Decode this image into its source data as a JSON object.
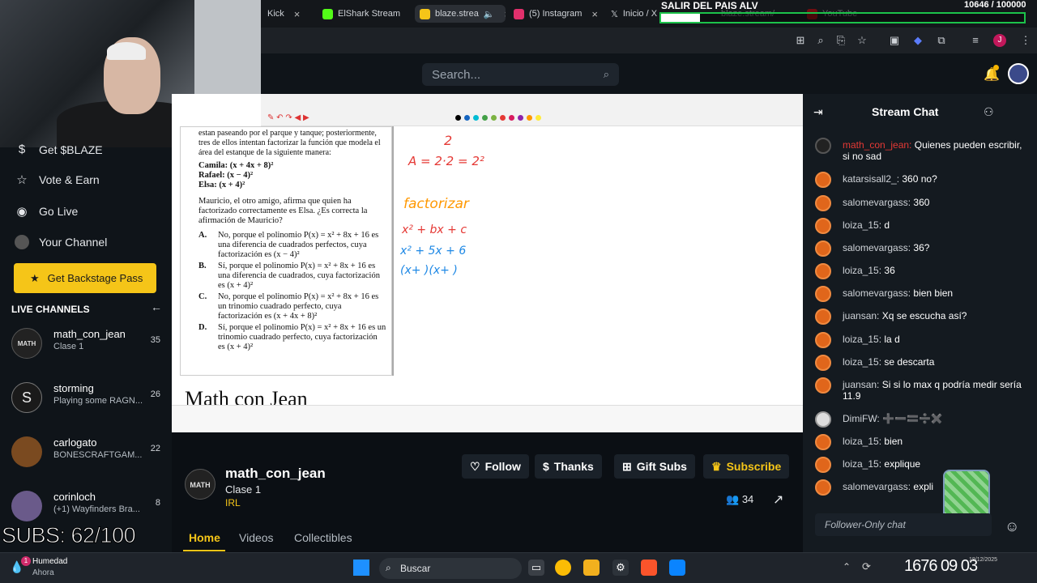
{
  "browser": {
    "tabs": [
      {
        "label": "Kick",
        "favicon_color": "#53fc18"
      },
      {
        "label": "ElShark Stream",
        "favicon_color": "#53fc18"
      },
      {
        "label": "blaze.strea",
        "favicon_color": "#f5c518"
      },
      {
        "label": "(5) Instagram",
        "favicon_color": "#e1306c"
      },
      {
        "label": "Inicio / X",
        "favicon_color": "#ffffff"
      }
    ],
    "overlay_tabs": [
      "blaze.stream/",
      "YouTube"
    ]
  },
  "goal": {
    "title": "SALIR DEL PAIS ALV",
    "count": "10646 / 100000",
    "progress_fraction": 0.1065
  },
  "header": {
    "search_placeholder": "Search..."
  },
  "sidebar": {
    "items": [
      {
        "label": "Get $BLAZE",
        "icon": "dollar-icon"
      },
      {
        "label": "Vote & Earn",
        "icon": "star-icon"
      },
      {
        "label": "Go Live",
        "icon": "broadcast-icon"
      },
      {
        "label": "Your Channel",
        "icon": "avatar"
      }
    ],
    "backstage_label": "Get Backstage Pass",
    "live_channels_heading": "LIVE CHANNELS",
    "channels": [
      {
        "name": "math_con_jean",
        "subtitle": "Clase 1",
        "viewers": "35",
        "avatar_color": "#222222"
      },
      {
        "name": "storming",
        "subtitle": "Playing some RAGN...",
        "viewers": "26",
        "avatar_color": "#1a1a1a"
      },
      {
        "name": "carlogato",
        "subtitle": "BONESCRAFTGAM...",
        "viewers": "22",
        "avatar_color": "#7a4a20"
      },
      {
        "name": "corinloch",
        "subtitle": "(+1) Wayfinders Bra...",
        "viewers": "8",
        "avatar_color": "#6a5a8a"
      }
    ]
  },
  "player": {
    "doc_text": {
      "intro": "estan paseando por el parque y tanque; posteriormente, tres de ellos intentan factorizar la función que modela el área del estanque de la siguiente manera:",
      "camila": "Camila: (x + 4x + 8)²",
      "rafael": "Rafael: (x − 4)²",
      "elsa": "Elsa: (x + 4)²",
      "question": "Mauricio, el otro amigo, afirma que quien ha factorizado correctamente es Elsa. ¿Es correcta la afirmación de Mauricio?",
      "options": [
        {
          "key": "A.",
          "text": "No, porque el polinomio P(x) = x² + 8x + 16 es una diferencia de cuadrados perfectos, cuya factorización es (x − 4)²"
        },
        {
          "key": "B.",
          "text": "Sí, porque el polinomio P(x) = x² + 8x + 16 es una diferencia de cuadrados, cuya factorización es (x + 4)²"
        },
        {
          "key": "C.",
          "text": "No, porque el polinomio P(x) = x² + 8x + 16 es un trinomio cuadrado perfecto, cuya factorización es (x + 4x + 8)²"
        },
        {
          "key": "D.",
          "text": "Sí, porque el polinomio P(x) = x² + 8x + 16 es un trinomio cuadrado perfecto, cuya factorización es (x + 4)²"
        }
      ]
    },
    "whiteboard": {
      "line1": "2",
      "line2": "A = 2·2 = 2²",
      "line3": "factorizar",
      "line4": "x² + bx + c",
      "line5": "x² + 5x + 6",
      "line6": "(x+ )(x+ )"
    },
    "logo_text": "Math con Jean"
  },
  "stream": {
    "channel_name": "math_con_jean",
    "title": "Clase 1",
    "category": "IRL",
    "avatar_text": "MATH",
    "buttons": {
      "follow": "Follow",
      "thanks": "Thanks",
      "gift": "Gift Subs",
      "subscribe": "Subscribe"
    },
    "viewers": "34",
    "tabs": [
      "Home",
      "Videos",
      "Collectibles"
    ]
  },
  "subs_overlay": "SUBS: 62/100",
  "chat": {
    "title": "Stream Chat",
    "messages": [
      {
        "user": "math_con_jean:",
        "text": "Quienes pueden escribir, si no sad",
        "top": 0
      },
      {
        "user": "katarsisall2_:",
        "text": "360 no?"
      },
      {
        "user": "salomevargass:",
        "text": "360"
      },
      {
        "user": "loiza_15:",
        "text": "d"
      },
      {
        "user": "salomevargass:",
        "text": "36?"
      },
      {
        "user": "loiza_15:",
        "text": "36"
      },
      {
        "user": "salomevargass:",
        "text": "bien bien"
      },
      {
        "user": "juansan:",
        "text": "Xq se escucha así?"
      },
      {
        "user": "loiza_15:",
        "text": "la d"
      },
      {
        "user": "loiza_15:",
        "text": "se descarta"
      },
      {
        "user": "juansan:",
        "text": "Si si lo max q podría medir sería 11.9"
      },
      {
        "user": "DimiFW:",
        "text": "➕➖🟰➗✖️"
      },
      {
        "user": "loiza_15:",
        "text": "bien"
      },
      {
        "user": "loiza_15:",
        "text": "explique"
      },
      {
        "user": "salomevargass:",
        "text": "expli"
      }
    ],
    "input_placeholder": "Follower-Only chat"
  },
  "taskbar": {
    "weather_title": "Humedad",
    "weather_sub": "Ahora",
    "notif_count": "1",
    "search_label": "Buscar",
    "clock": "1676 09 03",
    "date": "18/12/2025"
  }
}
